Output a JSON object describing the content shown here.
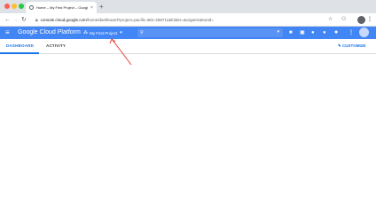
{
  "browser": {
    "window_controls": {
      "colors": [
        "#fe5f57",
        "#febc2e",
        "#28c840"
      ]
    },
    "tab": {
      "title": "Home – My First Project – Googl",
      "close": "×"
    },
    "new_tab": "+",
    "url_host": "console.cloud.google.com",
    "url_path": "/home/dashboard?project=pacific-attic-258711&folder=&organizationId=",
    "icons": [
      "back-icon",
      "forward-icon",
      "reload-icon",
      "lock-icon",
      "star-icon",
      "extension-icon",
      "profile-icon",
      "menu-icon"
    ]
  },
  "header": {
    "product_name": "Google Cloud Platform",
    "project_name": "My First Project",
    "project_caret": "▾",
    "accent": "#4285f4",
    "icons": [
      "hamburger-icon",
      "project-icon",
      "search-icon",
      "gift-icon",
      "terminal-icon",
      "help-icon",
      "bell-icon",
      "more-icon",
      "avatar"
    ]
  },
  "subnav": {
    "tabs": [
      {
        "label": "DASHBOARD",
        "active": true
      },
      {
        "label": "ACTIVITY",
        "active": false
      }
    ],
    "customize_label": "CUSTOMIZE",
    "active_color": "#1a73e8"
  },
  "annotation": {
    "color": "#ea4335"
  }
}
